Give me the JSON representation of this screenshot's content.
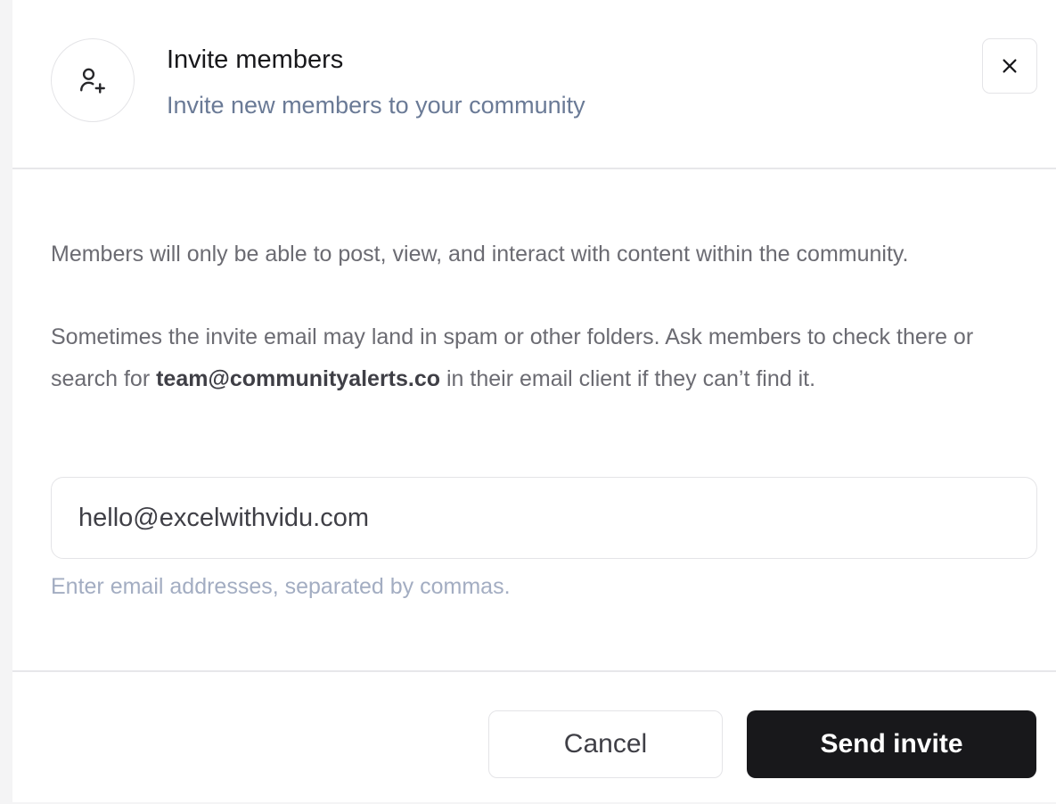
{
  "dialog": {
    "title": "Invite members",
    "subtitle": "Invite new members to your community",
    "icon": "user-plus-icon",
    "close_icon": "close-icon"
  },
  "body": {
    "paragraph1": "Members will only be able to post, view, and interact with content within the community.",
    "paragraph2_prefix": "Sometimes the invite email may land in spam or other folders. Ask members to check there or search for ",
    "paragraph2_email": "team@communityalerts.co",
    "paragraph2_suffix": " in their email client if they can’t find it.",
    "email_input_value": "hello@excelwithvidu.com",
    "email_hint": "Enter email addresses, separated by commas."
  },
  "footer": {
    "cancel_label": "Cancel",
    "send_label": "Send invite"
  },
  "colors": {
    "primary_button": "#18181b",
    "subtitle": "#6a7a96",
    "hint": "#a3adc2"
  }
}
